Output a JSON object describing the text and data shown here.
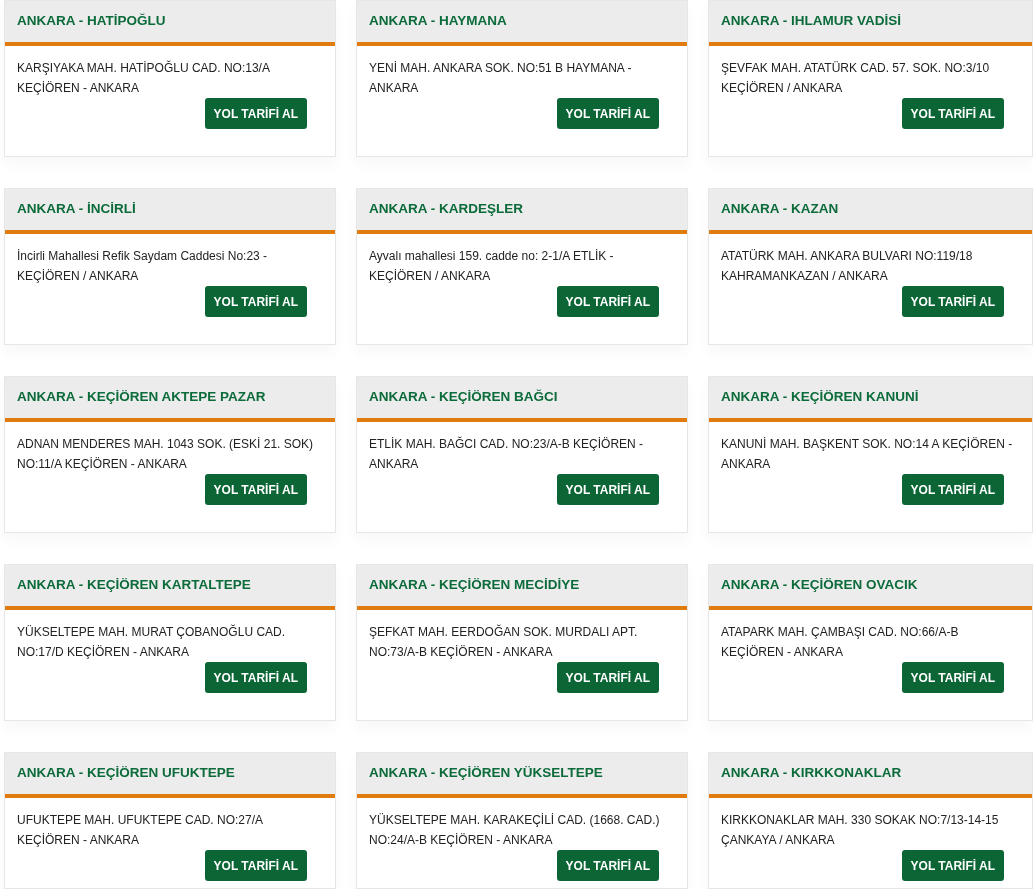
{
  "branches": [
    {
      "title": "ANKARA - HATİPOĞLU",
      "address": "KARŞIYAKA MAH. HATİPOĞLU CAD. NO:13/A KEÇİÖREN - ANKARA",
      "button": "YOL TARİFİ AL"
    },
    {
      "title": "ANKARA - HAYMANA",
      "address": "YENİ MAH. ANKARA SOK. NO:51 B HAYMANA - ANKARA",
      "button": "YOL TARİFİ AL"
    },
    {
      "title": "ANKARA - IHLAMUR VADİSİ",
      "address": "ŞEVFAK MAH. ATATÜRK CAD. 57. SOK. NO:3/10 KEÇİÖREN / ANKARA",
      "button": "YOL TARİFİ AL"
    },
    {
      "title": "ANKARA - İNCİRLİ",
      "address": "İncirli Mahallesi Refik Saydam Caddesi No:23 - KEÇİÖREN / ANKARA",
      "button": "YOL TARİFİ AL"
    },
    {
      "title": "ANKARA - KARDEŞLER",
      "address": "Ayvalı mahallesi 159. cadde no: 2-1/A ETLİK - KEÇİÖREN / ANKARA",
      "button": "YOL TARİFİ AL"
    },
    {
      "title": "ANKARA - KAZAN",
      "address": "ATATÜRK MAH. ANKARA BULVARI NO:119/18 KAHRAMANKAZAN / ANKARA",
      "button": "YOL TARİFİ AL"
    },
    {
      "title": "ANKARA - KEÇİÖREN AKTEPE PAZAR",
      "address": "ADNAN MENDERES MAH. 1043 SOK. (ESKİ 21. SOK) NO:11/A KEÇİÖREN - ANKARA",
      "button": "YOL TARİFİ AL"
    },
    {
      "title": "ANKARA - KEÇİÖREN BAĞCI",
      "address": "ETLİK MAH. BAĞCI CAD. NO:23/A-B KEÇİÖREN - ANKARA",
      "button": "YOL TARİFİ AL"
    },
    {
      "title": "ANKARA - KEÇİÖREN KANUNİ",
      "address": "KANUNİ MAH. BAŞKENT SOK. NO:14 A KEÇİÖREN - ANKARA",
      "button": "YOL TARİFİ AL"
    },
    {
      "title": "ANKARA - KEÇİÖREN KARTALTEPE",
      "address": "YÜKSELTEPE MAH. MURAT ÇOBANOĞLU CAD. NO:17/D KEÇİÖREN - ANKARA",
      "button": "YOL TARİFİ AL"
    },
    {
      "title": "ANKARA - KEÇİÖREN MECİDİYE",
      "address": "ŞEFKAT MAH. EERDOĞAN SOK. MURDALI APT. NO:73/A-B KEÇİÖREN - ANKARA",
      "button": "YOL TARİFİ AL"
    },
    {
      "title": "ANKARA - KEÇİÖREN OVACIK",
      "address": "ATAPARK MAH. ÇAMBAŞI CAD. NO:66/A-B KEÇİÖREN - ANKARA",
      "button": "YOL TARİFİ AL"
    },
    {
      "title": "ANKARA - KEÇİÖREN UFUKTEPE",
      "address": "UFUKTEPE MAH. UFUKTEPE CAD. NO:27/A KEÇİÖREN - ANKARA",
      "button": "YOL TARİFİ AL"
    },
    {
      "title": "ANKARA - KEÇİÖREN YÜKSELTEPE",
      "address": "YÜKSELTEPE MAH. KARAKEÇİLİ CAD. (1668. CAD.) NO:24/A-B KEÇİÖREN - ANKARA",
      "button": "YOL TARİFİ AL"
    },
    {
      "title": "ANKARA - KIRKKONAKLAR",
      "address": "KIRKKONAKLAR MAH. 330 SOKAK NO:7/13-14-15 ÇANKAYA / ANKARA",
      "button": "YOL TARİFİ AL"
    }
  ]
}
